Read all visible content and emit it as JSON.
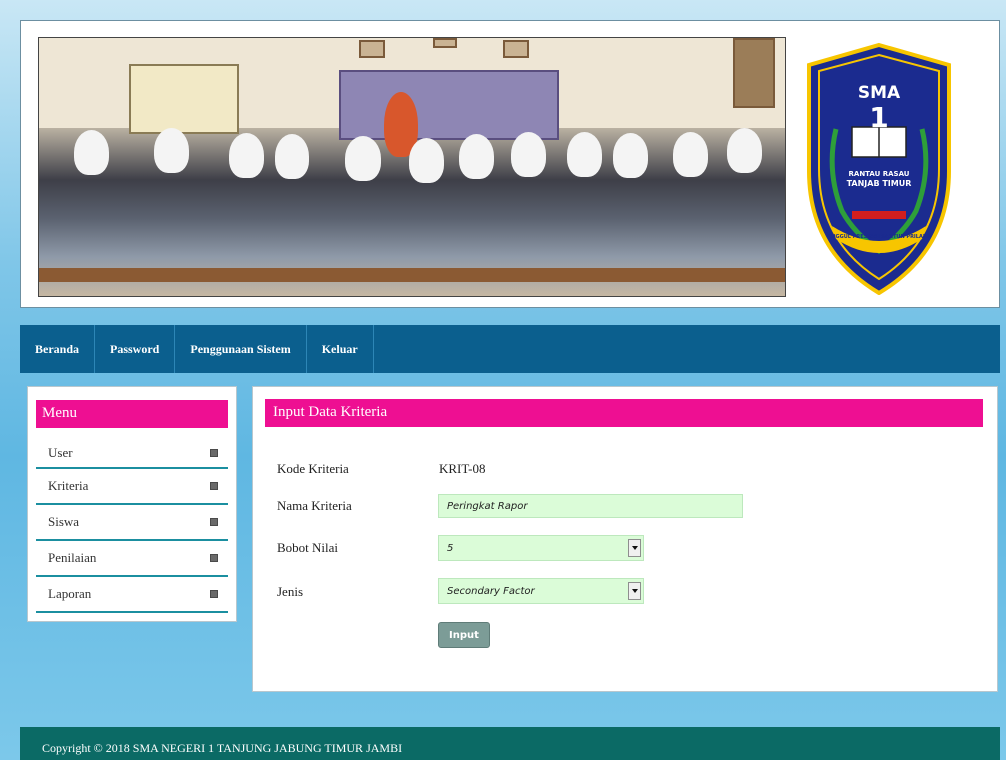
{
  "header": {
    "logo": {
      "title": "SMA",
      "number": "1",
      "place_line1": "RANTAU RASAU",
      "place_line2": "TANJAB TIMUR",
      "motto": "UNGGUL PRESTASI SANTUN PRILAKU"
    }
  },
  "nav": {
    "items": [
      {
        "label": "Beranda"
      },
      {
        "label": "Password"
      },
      {
        "label": "Penggunaan Sistem"
      },
      {
        "label": "Keluar"
      }
    ]
  },
  "sidebar": {
    "title": "Menu",
    "items": [
      {
        "label": "User"
      },
      {
        "label": "Kriteria"
      },
      {
        "label": "Siswa"
      },
      {
        "label": "Penilaian"
      },
      {
        "label": "Laporan"
      }
    ]
  },
  "form": {
    "title": "Input Data Kriteria",
    "kode_label": "Kode Kriteria",
    "kode_value": "KRIT-08",
    "nama_label": "Nama Kriteria",
    "nama_value": "Peringkat Rapor",
    "bobot_label": "Bobot Nilai",
    "bobot_value": "5",
    "jenis_label": "Jenis",
    "jenis_value": "Secondary Factor",
    "submit_label": "Input"
  },
  "footer": {
    "text": "Copyright © 2018 SMA NEGERI 1 TANJUNG JABUNG TIMUR JAMBI"
  },
  "colors": {
    "accent": "#ee0f92",
    "nav": "#0b5f8e",
    "footer": "#0b6a65",
    "input_bg": "#dbfcd8"
  }
}
